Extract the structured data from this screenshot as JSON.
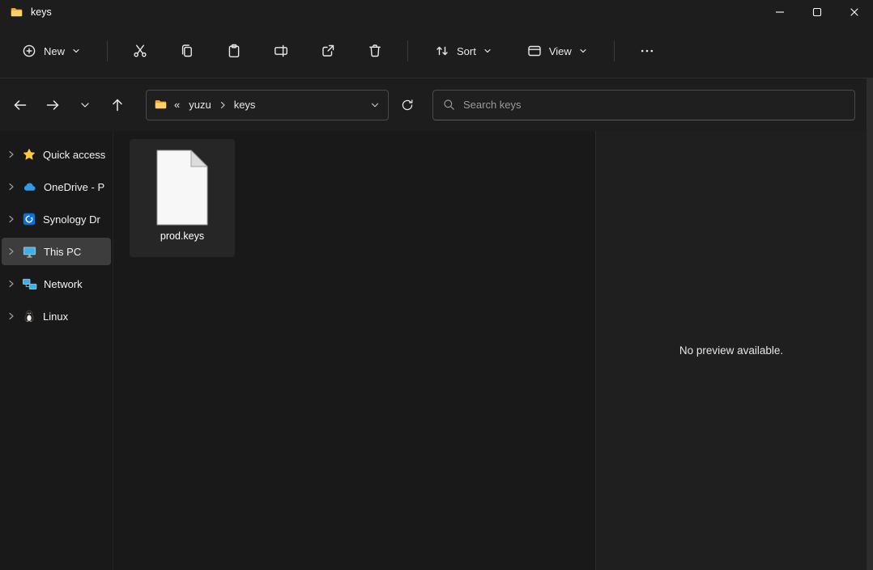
{
  "window": {
    "title": "keys"
  },
  "toolbar": {
    "new_label": "New",
    "sort_label": "Sort",
    "view_label": "View"
  },
  "address": {
    "overflow": "«",
    "crumbs": [
      {
        "label": "yuzu"
      },
      {
        "label": "keys"
      }
    ]
  },
  "search": {
    "placeholder": "Search keys",
    "value": ""
  },
  "sidebar": {
    "items": [
      {
        "label": "Quick access",
        "icon": "star-icon",
        "selected": false
      },
      {
        "label": "OneDrive - P",
        "icon": "cloud-icon",
        "selected": false
      },
      {
        "label": "Synology Dr",
        "icon": "synology-drive-icon",
        "selected": false
      },
      {
        "label": "This PC",
        "icon": "monitor-icon",
        "selected": true
      },
      {
        "label": "Network",
        "icon": "network-icon",
        "selected": false
      },
      {
        "label": "Linux",
        "icon": "penguin-icon",
        "selected": false
      }
    ]
  },
  "files": [
    {
      "name": "prod.keys",
      "icon": "blank-document-icon",
      "selected": true
    }
  ],
  "preview": {
    "message": "No preview available."
  },
  "icons": {
    "titlebar": [
      "folder-icon",
      "minimize-icon",
      "maximize-icon",
      "close-icon"
    ],
    "toolbar": [
      "plus-circle-icon",
      "chevron-down-icon",
      "cut-icon",
      "copy-icon",
      "paste-icon",
      "rename-icon",
      "share-icon",
      "delete-icon",
      "sort-arrows-icon",
      "view-panel-icon",
      "more-ellipsis-icon"
    ],
    "navigation": [
      "arrow-left-icon",
      "arrow-right-icon",
      "chevron-down-icon",
      "arrow-up-icon",
      "folder-icon",
      "chevron-right-icon",
      "refresh-icon",
      "search-icon"
    ]
  },
  "colors": {
    "chrome": "#1d1d1d",
    "content": "#191919",
    "preview_pane": "#1f1f1f",
    "selection": "#3d3d3d",
    "folder_yellow": "#fed06a",
    "accent_blue": "#36b2f2",
    "star_yellow": "#ffc83d"
  }
}
